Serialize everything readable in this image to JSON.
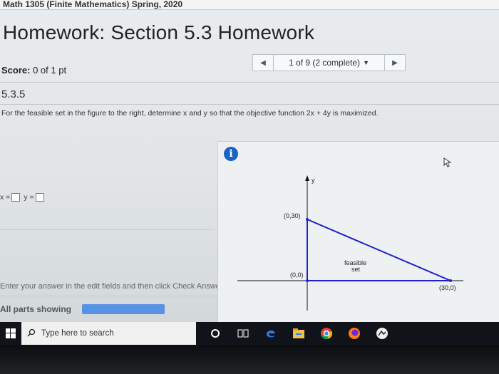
{
  "course_bar": {
    "text": "Math 1305 (Finite Mathematics) Spring, 2020"
  },
  "homework": {
    "title": "Homework: Section 5.3 Homework"
  },
  "score": {
    "label": "Score:",
    "value": "0 of 1 pt"
  },
  "question_nav": {
    "status": "1 of 9 (2 complete)"
  },
  "question": {
    "number": "5.3.5",
    "prompt": "For the feasible set in the figure to the right, determine x and y so that the objective function 2x + 4y is maximized.",
    "x_label": "x =",
    "y_label": "y =",
    "x_value": "",
    "y_value": "",
    "instructions": "Enter your answer in the edit fields and then click Check Answer.",
    "parts_label": "All parts showing"
  },
  "figure": {
    "info_icon": "i",
    "y_axis_label": "y",
    "points": [
      {
        "label": "(0,30)"
      },
      {
        "label": "(0,0)"
      },
      {
        "label": "(30,0)"
      }
    ],
    "region_label_1": "feasible",
    "region_label_2": "set",
    "colors": {
      "region_edge": "#1f1fcf",
      "axis": "#111111"
    }
  },
  "taskbar": {
    "search_placeholder": "Type here to search",
    "icons": [
      "windows-start-icon",
      "search-icon",
      "cortana-icon",
      "task-view-icon",
      "edge-icon",
      "file-explorer-icon",
      "chrome-icon",
      "firefox-icon",
      "app-icon"
    ]
  }
}
